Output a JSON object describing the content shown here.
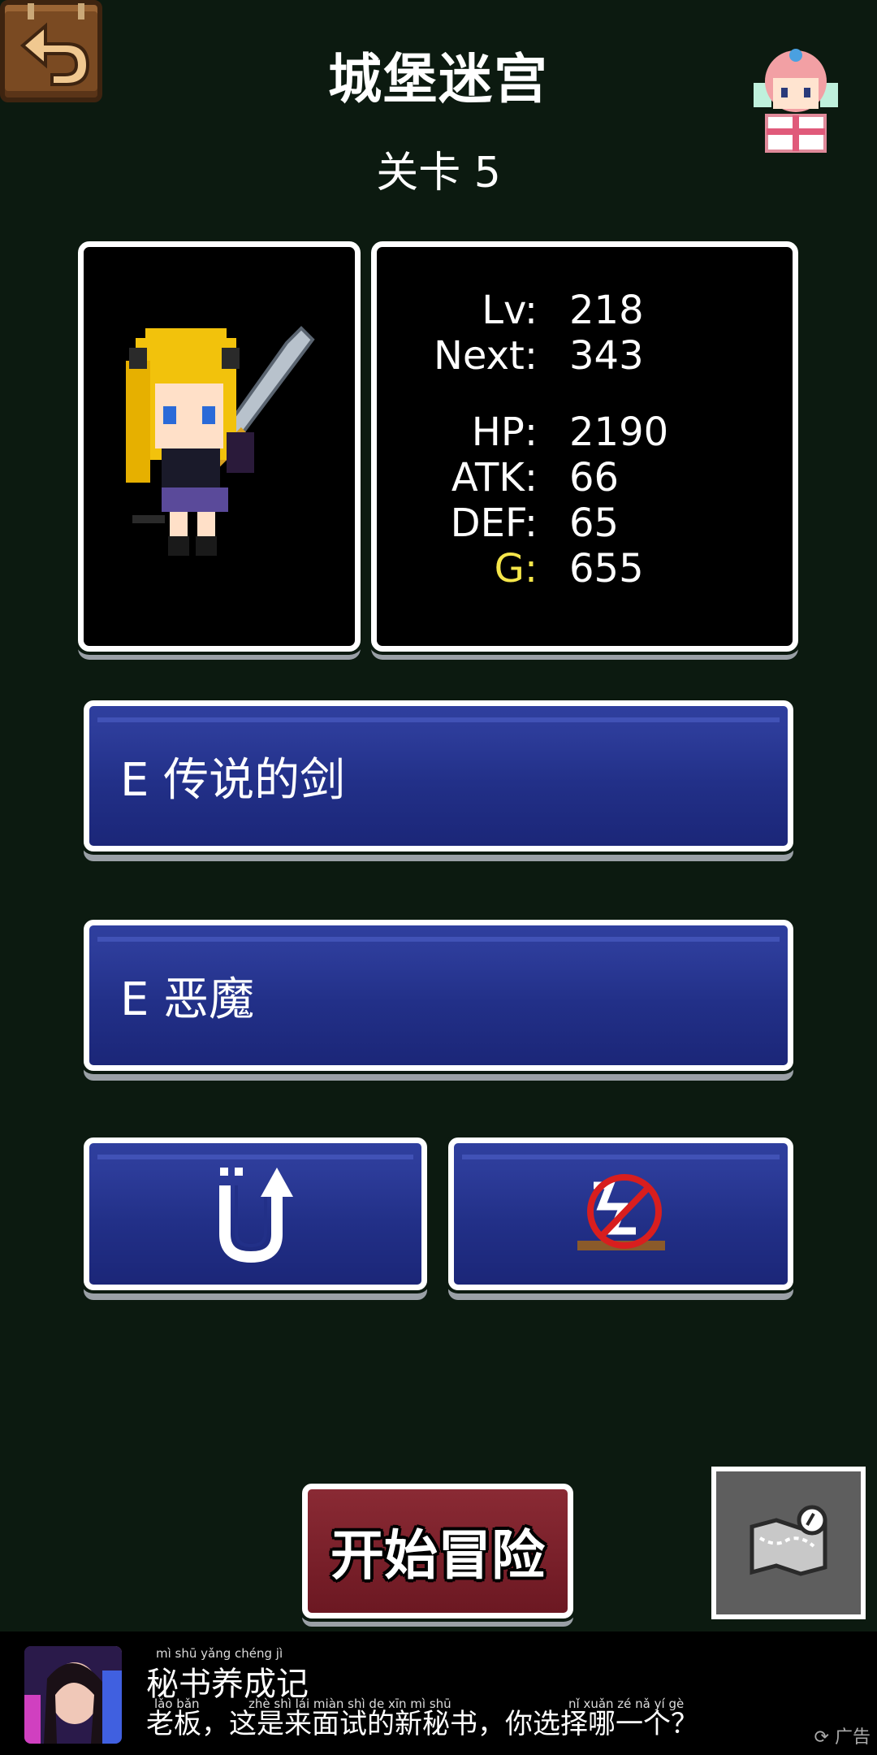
{
  "header": {
    "title": "城堡迷宫",
    "level": "关卡 5"
  },
  "stats": {
    "lv_label": "Lv:",
    "lv": "218",
    "next_label": "Next:",
    "next": "343",
    "hp_label": "HP:",
    "hp": "2190",
    "atk_label": "ATK:",
    "atk": "66",
    "def_label": "DEF:",
    "def": "65",
    "g_label": "G:",
    "g": "655"
  },
  "equipment": {
    "weapon": "E 传说的剑",
    "armor": "E 恶魔"
  },
  "actions": {
    "start": "开始冒险"
  },
  "ad": {
    "title": "秘书养成记",
    "subtitle": "老板，这是来面试的新秘书，你选择哪一个？",
    "tag": "广告",
    "pinyin_title": "mì shū yǎng chéng jì",
    "pinyin_sub_1": "lǎo bǎn",
    "pinyin_sub_2": "zhè shì lái miàn shì de xīn mì shū",
    "pinyin_sub_3": "nǐ xuǎn zé nǎ yí gè"
  },
  "colors": {
    "background": "#0c1a10",
    "gold_label": "#f5e64a",
    "blue_button": "#223088",
    "start_button": "#7a1f2c"
  },
  "icons": {
    "back": "back-arrow-icon",
    "fairy": "fairy-gift-icon",
    "retreat": "u-turn-icon",
    "no_stairs": "no-stairs-icon",
    "map": "map-icon"
  }
}
